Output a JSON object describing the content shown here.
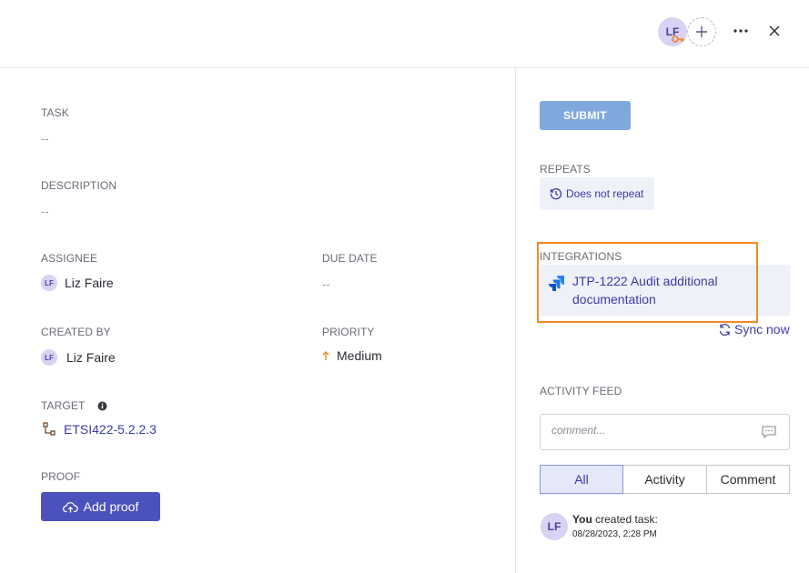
{
  "header": {
    "avatar_initials": "LF",
    "actions": [
      "add-watcher",
      "more",
      "close"
    ]
  },
  "fields": {
    "task": {
      "label": "TASK",
      "value": "--"
    },
    "description": {
      "label": "DESCRIPTION",
      "value": "--"
    },
    "assignee": {
      "label": "ASSIGNEE",
      "initials": "LF",
      "name": "Liz Faire"
    },
    "due_date": {
      "label": "DUE DATE",
      "value": "--"
    },
    "created_by": {
      "label": "CREATED BY",
      "initials": "LF",
      "name": "Liz Faire"
    },
    "priority": {
      "label": "PRIORITY",
      "value": "Medium",
      "color": "#f08a24"
    },
    "target": {
      "label": "TARGET",
      "value": "ETSI422-5.2.2.3"
    },
    "proof": {
      "label": "PROOF",
      "button_label": "Add proof"
    }
  },
  "right": {
    "submit_label": "SUBMIT",
    "repeats": {
      "label": "REPEATS",
      "value": "Does not repeat"
    },
    "integrations": {
      "label": "INTEGRATIONS",
      "item": "JTP-1222 Audit additional documentation",
      "sync_label": "Sync now"
    },
    "activity_feed": {
      "label": "ACTIVITY FEED",
      "comment_placeholder": "comment...",
      "tabs": [
        {
          "label": "All",
          "active": true
        },
        {
          "label": "Activity",
          "active": false
        },
        {
          "label": "Comment",
          "active": false
        }
      ],
      "entries": [
        {
          "initials": "LF",
          "actor": "You",
          "action": " created task:",
          "timestamp": "08/28/2023, 2:28 PM"
        }
      ]
    }
  },
  "colors": {
    "primary": "#4c52bd",
    "submit": "#7fa9dc",
    "link": "#3b3ba8",
    "highlight": "#f08a24"
  }
}
